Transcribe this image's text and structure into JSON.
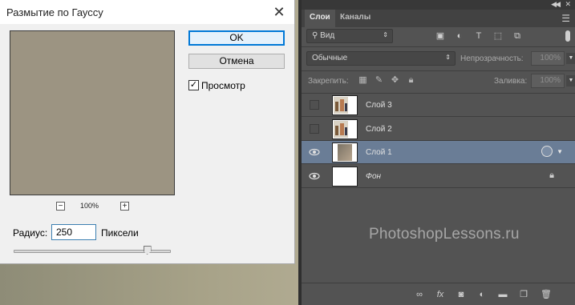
{
  "dialog": {
    "title": "Размытие по Гауссу",
    "ok_label": "OK",
    "cancel_label": "Отмена",
    "preview_label": "Просмотр",
    "preview_checked": true,
    "zoom_value": "100%",
    "radius_label": "Радиус:",
    "radius_value": "250",
    "radius_units": "Пиксели",
    "radius_slider_fraction": 0.85
  },
  "panel": {
    "tabs": [
      {
        "label": "Слои",
        "active": true
      },
      {
        "label": "Каналы",
        "active": false
      }
    ],
    "filter_kind": "Вид",
    "blend_mode": "Обычные",
    "opacity_label": "Непрозрачность:",
    "opacity_value": "100%",
    "lock_label": "Закрепить:",
    "fill_label": "Заливка:",
    "fill_value": "100%",
    "layers": [
      {
        "name": "Слой 3",
        "visible": false,
        "selected": false
      },
      {
        "name": "Слой 2",
        "visible": false,
        "selected": false
      },
      {
        "name": "Слой 1",
        "visible": true,
        "selected": true
      },
      {
        "name": "Фон",
        "visible": true,
        "selected": false,
        "locked": true
      }
    ],
    "watermark": "PhotoshopLessons.ru"
  },
  "colors": {
    "panel_bg": "#535353",
    "selected_layer": "#6a7d96",
    "preview_fill": "#9c9482",
    "ok_border": "#0078d7"
  }
}
